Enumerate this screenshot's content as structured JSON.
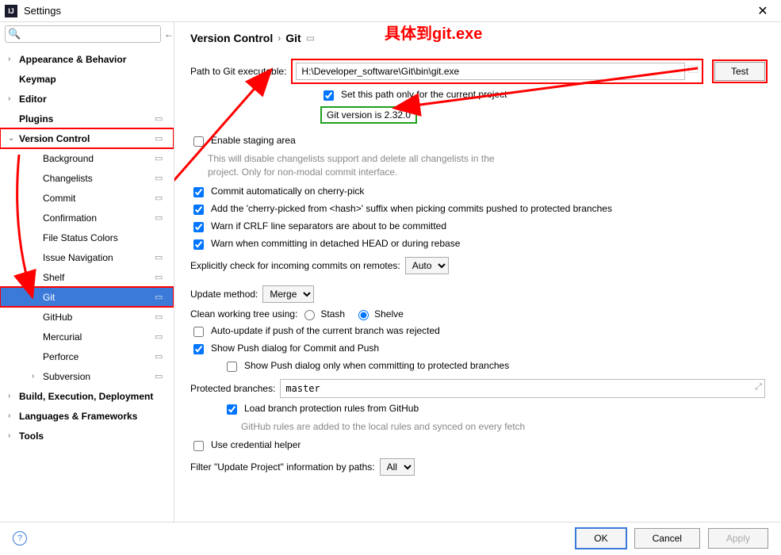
{
  "window": {
    "title": "Settings"
  },
  "search": {
    "placeholder": ""
  },
  "annotation": {
    "text": "具体到git.exe"
  },
  "sidebar": {
    "items": [
      {
        "label": "Appearance & Behavior",
        "bold": true,
        "expandable": true,
        "indent": 0,
        "proj": false
      },
      {
        "label": "Keymap",
        "bold": true,
        "expandable": false,
        "indent": 0,
        "proj": false
      },
      {
        "label": "Editor",
        "bold": true,
        "expandable": true,
        "indent": 0,
        "proj": false
      },
      {
        "label": "Plugins",
        "bold": true,
        "expandable": false,
        "indent": 0,
        "proj": true
      },
      {
        "label": "Version Control",
        "bold": true,
        "expandable": true,
        "expanded": true,
        "indent": 0,
        "proj": true,
        "boxed": true
      },
      {
        "label": "Background",
        "bold": false,
        "expandable": false,
        "indent": 1,
        "proj": true
      },
      {
        "label": "Changelists",
        "bold": false,
        "expandable": false,
        "indent": 1,
        "proj": true
      },
      {
        "label": "Commit",
        "bold": false,
        "expandable": false,
        "indent": 1,
        "proj": true
      },
      {
        "label": "Confirmation",
        "bold": false,
        "expandable": false,
        "indent": 1,
        "proj": true
      },
      {
        "label": "File Status Colors",
        "bold": false,
        "expandable": false,
        "indent": 1,
        "proj": false
      },
      {
        "label": "Issue Navigation",
        "bold": false,
        "expandable": false,
        "indent": 1,
        "proj": true
      },
      {
        "label": "Shelf",
        "bold": false,
        "expandable": false,
        "indent": 1,
        "proj": true
      },
      {
        "label": "Git",
        "bold": false,
        "expandable": false,
        "indent": 1,
        "proj": true,
        "selected": true,
        "boxed": true
      },
      {
        "label": "GitHub",
        "bold": false,
        "expandable": false,
        "indent": 1,
        "proj": true
      },
      {
        "label": "Mercurial",
        "bold": false,
        "expandable": false,
        "indent": 1,
        "proj": true
      },
      {
        "label": "Perforce",
        "bold": false,
        "expandable": false,
        "indent": 1,
        "proj": true
      },
      {
        "label": "Subversion",
        "bold": false,
        "expandable": true,
        "indent": 1,
        "proj": true
      },
      {
        "label": "Build, Execution, Deployment",
        "bold": true,
        "expandable": true,
        "indent": 0,
        "proj": false
      },
      {
        "label": "Languages & Frameworks",
        "bold": true,
        "expandable": true,
        "indent": 0,
        "proj": false
      },
      {
        "label": "Tools",
        "bold": true,
        "expandable": true,
        "indent": 0,
        "proj": false
      }
    ]
  },
  "breadcrumb": {
    "parent": "Version Control",
    "current": "Git"
  },
  "git": {
    "path_label": "Path to Git executable:",
    "path_value": "H:\\Developer_software\\Git\\bin\\git.exe",
    "test_label": "Test",
    "set_project_only": "Set this path only for the current project",
    "version_text": "Git version is 2.32.0",
    "enable_staging": "Enable staging area",
    "enable_staging_hint": "This will disable changelists support and delete all changelists in the project. Only for non-modal commit interface.",
    "commit_auto_cherry": "Commit automatically on cherry-pick",
    "add_cherry_suffix": "Add the 'cherry-picked from <hash>' suffix when picking commits pushed to protected branches",
    "warn_crlf": "Warn if CRLF line separators are about to be committed",
    "warn_detached": "Warn when committing in detached HEAD or during rebase",
    "explicit_check_label": "Explicitly check for incoming commits on remotes:",
    "explicit_check_value": "Auto",
    "update_method_label": "Update method:",
    "update_method_value": "Merge",
    "clean_tree_label": "Clean working tree using:",
    "clean_tree_stash": "Stash",
    "clean_tree_shelve": "Shelve",
    "auto_update_rejected": "Auto-update if push of the current branch was rejected",
    "show_push_dialog": "Show Push dialog for Commit and Push",
    "show_push_protected": "Show Push dialog only when committing to protected branches",
    "protected_label": "Protected branches:",
    "protected_value": "master",
    "load_branch_rules": "Load branch protection rules from GitHub",
    "load_branch_rules_hint": "GitHub rules are added to the local rules and synced on every fetch",
    "use_credential_helper": "Use credential helper",
    "filter_update_label": "Filter \"Update Project\" information by paths:",
    "filter_update_value": "All"
  },
  "footer": {
    "ok": "OK",
    "cancel": "Cancel",
    "apply": "Apply"
  }
}
